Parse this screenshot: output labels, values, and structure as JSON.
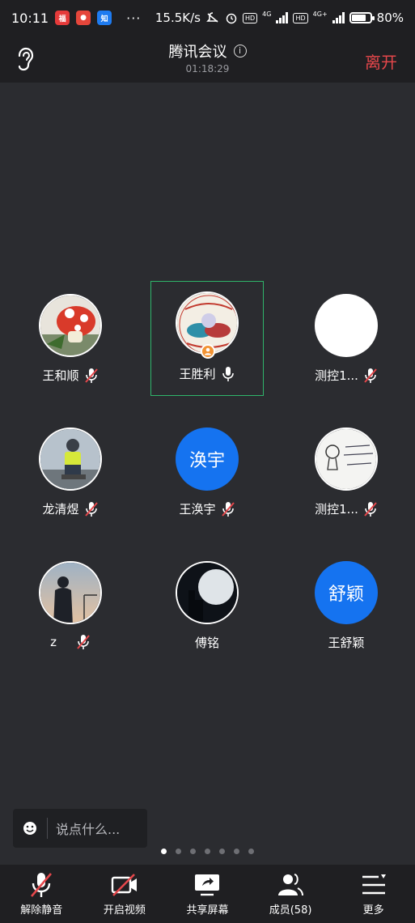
{
  "status_bar": {
    "time": "10:11",
    "speed": "15.5K/s",
    "net1": "4G",
    "net2": "4G+",
    "hd": "HD",
    "battery": "80%",
    "battery_level": 0.8,
    "app_badges": [
      "app1-icon",
      "app2-icon",
      "zhihu-icon"
    ]
  },
  "header": {
    "title": "腾讯会议",
    "timer": "01:18:29",
    "leave_label": "离开"
  },
  "participants": [
    {
      "name": "王和顺",
      "avatar_type": "image-mushroom",
      "mic": "muted"
    },
    {
      "name": "王胜利",
      "avatar_type": "image-badge",
      "mic": "active",
      "host": true,
      "speaking": true
    },
    {
      "name": "测控1...",
      "avatar_type": "white",
      "mic": "muted"
    },
    {
      "name": "龙清煜",
      "avatar_type": "image-child",
      "mic": "muted"
    },
    {
      "name": "王涣宇",
      "avatar_type": "text",
      "avatar_text": "涣宇",
      "mic": "muted"
    },
    {
      "name": "测控1...",
      "avatar_type": "image-sketch",
      "mic": "muted"
    },
    {
      "name": "z",
      "avatar_type": "image-silhouette",
      "mic": "muted"
    },
    {
      "name": "傅铭",
      "avatar_type": "image-moon",
      "mic": "none"
    },
    {
      "name": "王舒颖",
      "avatar_type": "text",
      "avatar_text": "舒颖",
      "mic": "none"
    }
  ],
  "chat": {
    "placeholder": "说点什么..."
  },
  "pager": {
    "total": 7,
    "current": 0
  },
  "toolbar": {
    "unmute_label": "解除静音",
    "video_label": "开启视频",
    "share_label": "共享屏幕",
    "members_label": "成员(58)",
    "more_label": "更多"
  },
  "colors": {
    "accent_blue": "#1573f0",
    "leave_red": "#e5474b",
    "mute_red": "#e5474b",
    "speaking_green": "#2fb56a",
    "background": "#2b2c30",
    "bar": "#1f1f22"
  }
}
